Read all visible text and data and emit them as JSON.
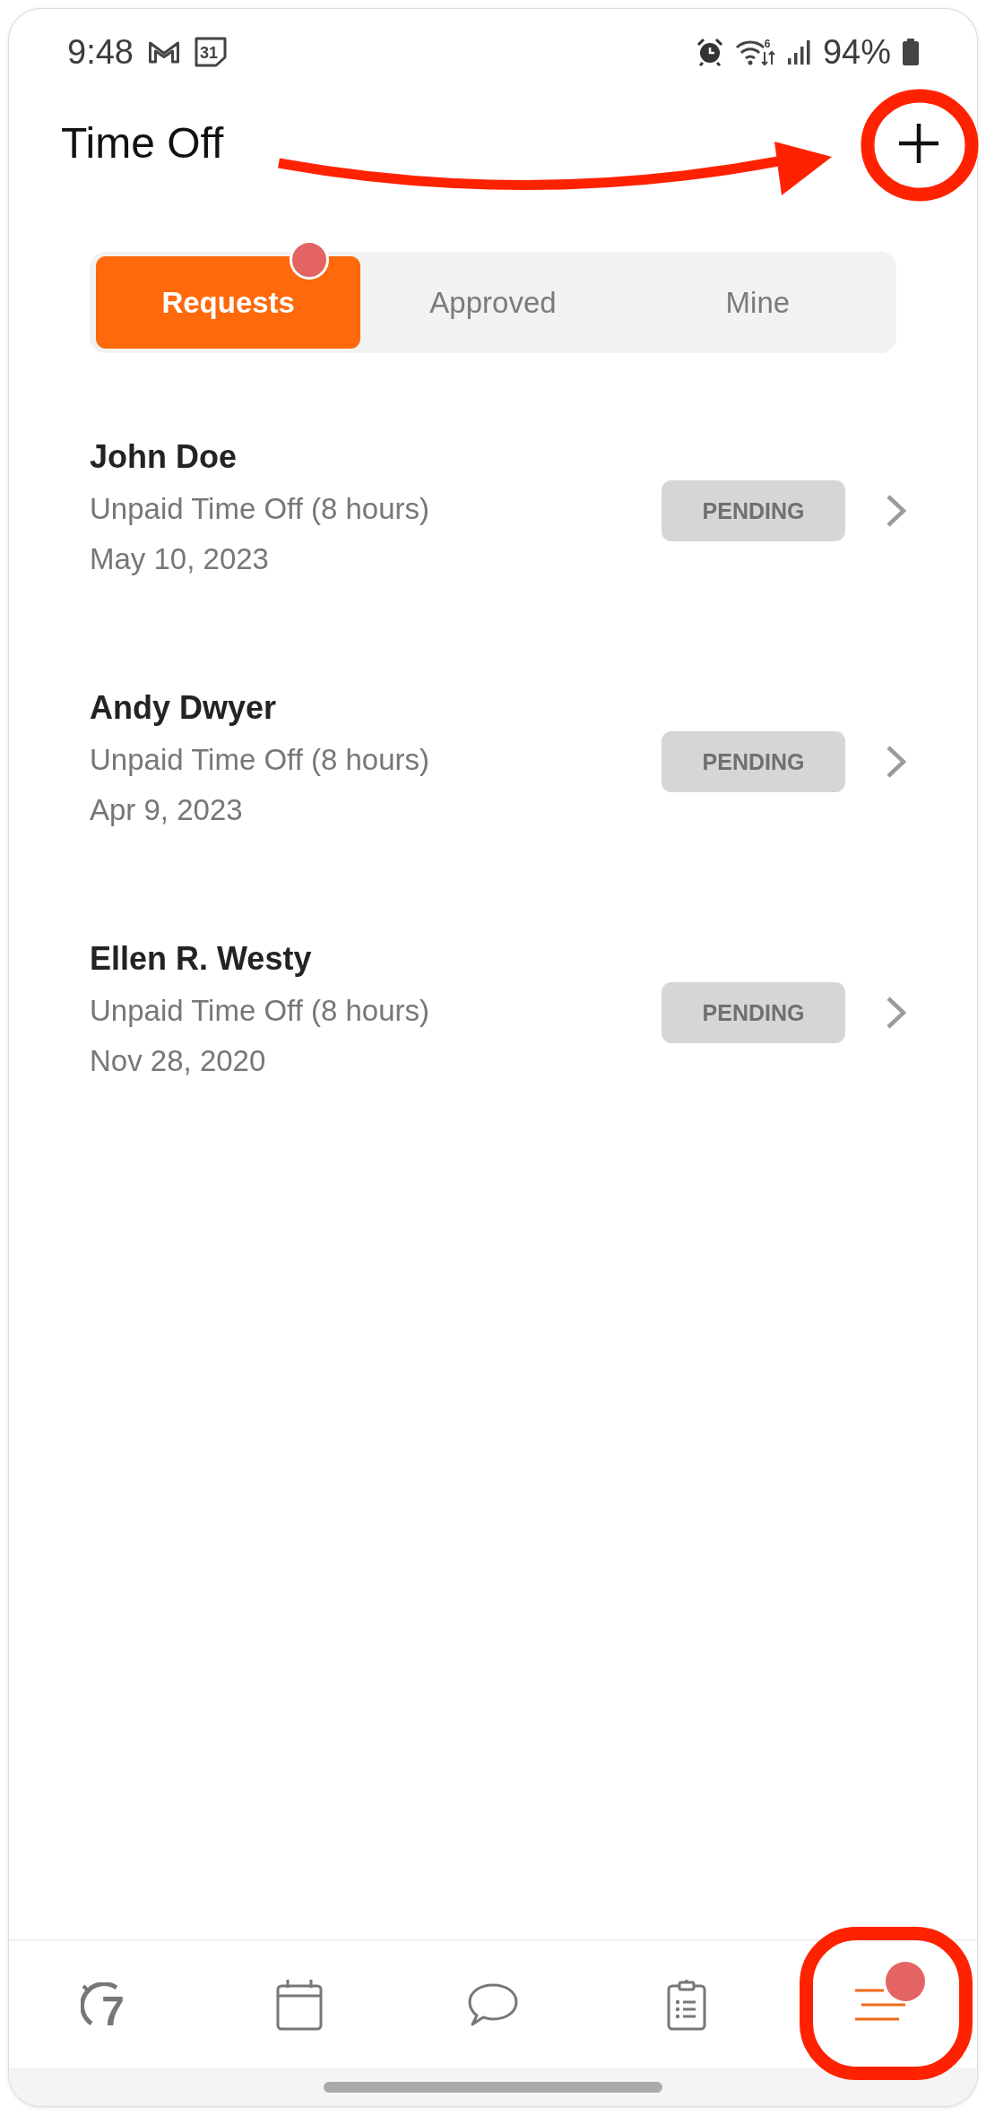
{
  "status_bar": {
    "time": "9:48",
    "calendar_day": "31",
    "wifi_generation": "6",
    "battery": "94%"
  },
  "header": {
    "title": "Time Off"
  },
  "tabs": [
    {
      "label": "Requests",
      "selected": true,
      "badge": true
    },
    {
      "label": "Approved",
      "selected": false,
      "badge": false
    },
    {
      "label": "Mine",
      "selected": false,
      "badge": false
    }
  ],
  "requests": [
    {
      "name": "John Doe",
      "type": "Unpaid Time Off (8 hours)",
      "date": "May 10, 2023",
      "status": "PENDING"
    },
    {
      "name": "Andy Dwyer",
      "type": "Unpaid Time Off (8 hours)",
      "date": "Apr 9, 2023",
      "status": "PENDING"
    },
    {
      "name": "Ellen R. Westy",
      "type": "Unpaid Time Off (8 hours)",
      "date": "Nov 28, 2020",
      "status": "PENDING"
    }
  ],
  "bottom_nav": [
    {
      "kind": "logo",
      "glyph": "7",
      "selected": false,
      "badge": false
    },
    {
      "kind": "calendar",
      "selected": false,
      "badge": false
    },
    {
      "kind": "chat",
      "selected": false,
      "badge": false
    },
    {
      "kind": "clipboard",
      "selected": false,
      "badge": false
    },
    {
      "kind": "menu",
      "selected": true,
      "badge": true
    }
  ]
}
